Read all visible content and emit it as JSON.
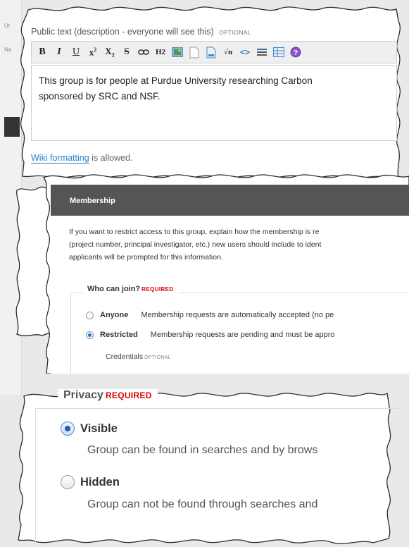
{
  "public_text": {
    "label": "Public text (description - everyone will see this)",
    "optional": "OPTIONAL",
    "toolbar": [
      {
        "name": "bold-button",
        "glyph": "B"
      },
      {
        "name": "italic-button",
        "glyph": "I"
      },
      {
        "name": "underline-button",
        "glyph": "U"
      },
      {
        "name": "superscript-button",
        "glyph": "x²"
      },
      {
        "name": "subscript-button",
        "glyph": "x₂"
      },
      {
        "name": "strikethrough-button",
        "glyph": "S"
      },
      {
        "name": "link-button",
        "glyph": "∞"
      },
      {
        "name": "heading-button",
        "glyph": "H2"
      },
      {
        "name": "image-button",
        "glyph": "img"
      },
      {
        "name": "file-button",
        "glyph": "file"
      },
      {
        "name": "document-button",
        "glyph": "doc"
      },
      {
        "name": "math-button",
        "glyph": "√n"
      },
      {
        "name": "code-button",
        "glyph": "<>"
      },
      {
        "name": "list-button",
        "glyph": "≡"
      },
      {
        "name": "table-button",
        "glyph": "tbl"
      },
      {
        "name": "help-button",
        "glyph": "?"
      }
    ],
    "text_line1": "This group is for people at Purdue University researching Carbon",
    "text_line2": "sponsored by SRC and NSF.",
    "wiki_link": "Wiki formatting",
    "wiki_suffix": " is allowed."
  },
  "membership": {
    "title": "Membership",
    "desc_line1": "If you want to restrict access to this group, explain how the membership is re",
    "desc_line2": "(project number, principal investigator, etc.) new users should include to ident",
    "desc_line3": "applicants will be prompted for this information.",
    "who_can_join": "Who can join?",
    "required": "REQUIRED",
    "options": [
      {
        "name": "Anyone",
        "desc": "Membership requests are automatically accepted (no pe",
        "selected": false
      },
      {
        "name": "Restricted",
        "desc": "Membership requests are pending and must be appro",
        "selected": true
      }
    ],
    "credentials": "Credentials",
    "optional": "OPTIONAL"
  },
  "privacy": {
    "title": "Privacy",
    "required": "REQUIRED",
    "options": [
      {
        "name": "Visible",
        "desc": "Group can be found in searches and by brows",
        "selected": true
      },
      {
        "name": "Hidden",
        "desc": "Group can not be found through searches and",
        "selected": false
      }
    ]
  },
  "colors": {
    "accent_link": "#2b7fc2",
    "required_red": "#dd0000",
    "header_gray": "#555555"
  }
}
